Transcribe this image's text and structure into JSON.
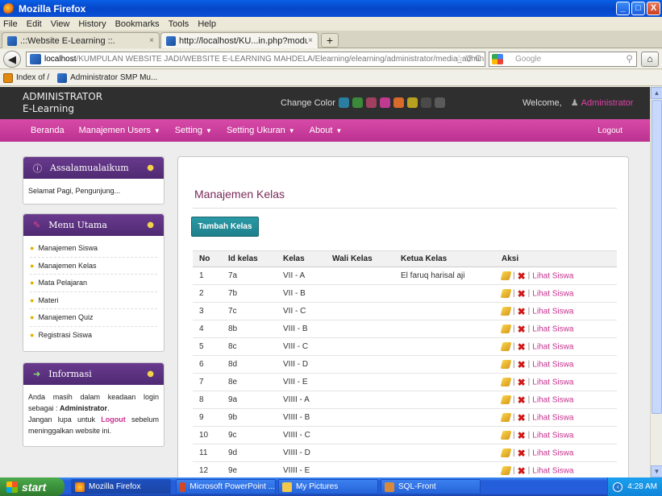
{
  "window": {
    "title": "Mozilla Firefox",
    "minimize": "_",
    "maximize": "□",
    "close": "X"
  },
  "menu": [
    "File",
    "Edit",
    "View",
    "History",
    "Bookmarks",
    "Tools",
    "Help"
  ],
  "tabs": [
    {
      "label": ".::Website E-Learning ::.",
      "close": "×"
    },
    {
      "label": "http://localhost/KU...in.php?module=kelas",
      "close": "×"
    }
  ],
  "newtab": "+",
  "url": {
    "host": "localhost",
    "path": "/KUMPULAN WEBSITE JADI/WEBSITE E-LEARNING MAHDELA/Elearning/elearning/administrator/media_admin.php?module",
    "controls": "☆ ▽ C"
  },
  "search": {
    "placeholder": "Google"
  },
  "bookmarks": [
    "Index of /",
    "Administrator SMP Mu..."
  ],
  "header": {
    "brand_line1": "ADMINISTRATOR",
    "brand_line2": "E-Learning",
    "change_color": "Change Color",
    "swatches": [
      "#2a7fa0",
      "#3a8a3a",
      "#a04060",
      "#c03a90",
      "#d86a2a",
      "#b8a020",
      "#4a4a4a",
      "#5a5a5a"
    ],
    "welcome": "Welcome,",
    "user": "Administrator"
  },
  "nav": {
    "items": [
      "Beranda",
      "Manajemen Users",
      "Setting",
      "Setting Ukuran",
      "About"
    ],
    "logout": "Logout"
  },
  "widgets": {
    "greet": {
      "title": "Assalamualaikum",
      "text": "Selamat Pagi, Pengunjung..."
    },
    "menu": {
      "title": "Menu Utama",
      "items": [
        "Manajemen Siswa",
        "Manajemen Kelas",
        "Mata Pelajaran",
        "Materi",
        "Manajemen Quiz",
        "Registrasi Siswa"
      ]
    },
    "info": {
      "title": "Informasi",
      "line1": "Anda masih dalam keadaan login sebagai :",
      "role": "Administrator",
      "line2a": "Jangan lupa untuk",
      "logout_word": "Logout",
      "line2b": "sebelum meninggalkan website ini."
    }
  },
  "content": {
    "title": "Manajemen Kelas",
    "add_button": "Tambah Kelas",
    "columns": [
      "No",
      "Id kelas",
      "Kelas",
      "Wali Kelas",
      "Ketua Kelas",
      "Aksi"
    ],
    "action_sep": "|",
    "action_view": "Lihat Siswa",
    "rows": [
      {
        "no": "1",
        "id": "7a",
        "kelas": "VII - A",
        "wali": "",
        "ketua": "El faruq harisal aji"
      },
      {
        "no": "2",
        "id": "7b",
        "kelas": "VII - B",
        "wali": "",
        "ketua": ""
      },
      {
        "no": "3",
        "id": "7c",
        "kelas": "VII - C",
        "wali": "",
        "ketua": ""
      },
      {
        "no": "4",
        "id": "8b",
        "kelas": "VIII - B",
        "wali": "",
        "ketua": ""
      },
      {
        "no": "5",
        "id": "8c",
        "kelas": "VIII - C",
        "wali": "",
        "ketua": ""
      },
      {
        "no": "6",
        "id": "8d",
        "kelas": "VIII - D",
        "wali": "",
        "ketua": ""
      },
      {
        "no": "7",
        "id": "8e",
        "kelas": "VIII - E",
        "wali": "",
        "ketua": ""
      },
      {
        "no": "8",
        "id": "9a",
        "kelas": "VIIII - A",
        "wali": "",
        "ketua": ""
      },
      {
        "no": "9",
        "id": "9b",
        "kelas": "VIIII - B",
        "wali": "",
        "ketua": ""
      },
      {
        "no": "10",
        "id": "9c",
        "kelas": "VIIII - C",
        "wali": "",
        "ketua": ""
      },
      {
        "no": "11",
        "id": "9d",
        "kelas": "VIIII - D",
        "wali": "",
        "ketua": ""
      },
      {
        "no": "12",
        "id": "9e",
        "kelas": "VIIII - E",
        "wali": "",
        "ketua": ""
      }
    ]
  },
  "taskbar": {
    "start": "start",
    "buttons": [
      "Mozilla Firefox",
      "Microsoft PowerPoint ...",
      "My Pictures",
      "SQL-Front"
    ],
    "clock": "4:28 AM"
  }
}
